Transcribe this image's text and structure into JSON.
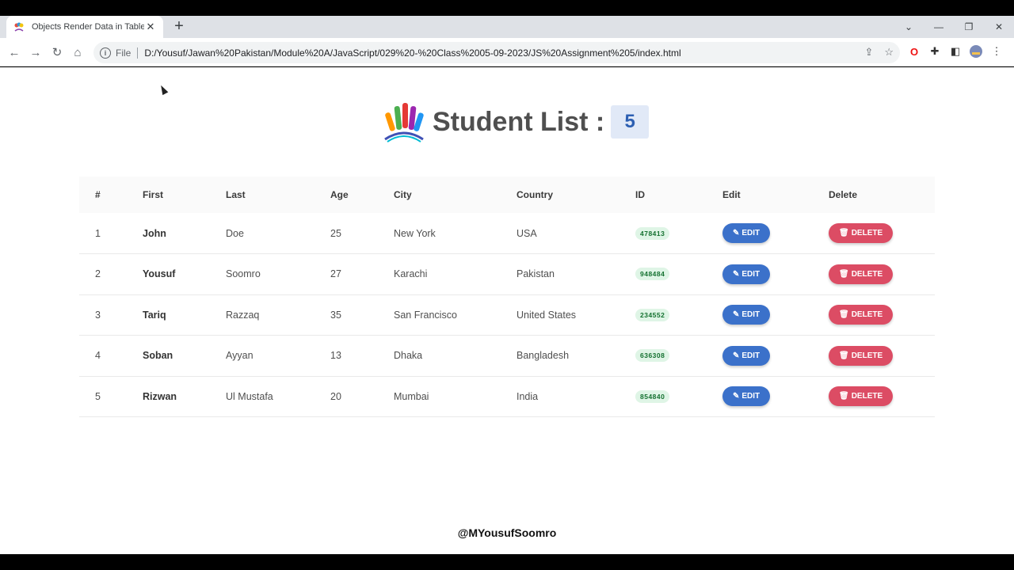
{
  "browser": {
    "tab_title": "Objects Render Data in Table",
    "url_scheme": "File",
    "url": "D:/Yousuf/Jawan%20Pakistan/Module%20A/JavaScript/029%20-%20Class%2005-09-2023/JS%20Assignment%205/index.html"
  },
  "page": {
    "heading": "Student List :",
    "count": "5",
    "footer_handle": "@MYousufSoomro"
  },
  "table": {
    "headers": [
      "#",
      "First",
      "Last",
      "Age",
      "City",
      "Country",
      "ID",
      "Edit",
      "Delete"
    ],
    "edit_label": "EDIT",
    "delete_label": "DELETE",
    "rows": [
      {
        "num": "1",
        "first": "John",
        "last": "Doe",
        "age": "25",
        "city": "New York",
        "country": "USA",
        "id": "478413"
      },
      {
        "num": "2",
        "first": "Yousuf",
        "last": "Soomro",
        "age": "27",
        "city": "Karachi",
        "country": "Pakistan",
        "id": "948484"
      },
      {
        "num": "3",
        "first": "Tariq",
        "last": "Razzaq",
        "age": "35",
        "city": "San Francisco",
        "country": "United States",
        "id": "234552"
      },
      {
        "num": "4",
        "first": "Soban",
        "last": "Ayyan",
        "age": "13",
        "city": "Dhaka",
        "country": "Bangladesh",
        "id": "636308"
      },
      {
        "num": "5",
        "first": "Rizwan",
        "last": "Ul Mustafa",
        "age": "20",
        "city": "Mumbai",
        "country": "India",
        "id": "854840"
      }
    ]
  },
  "colors": {
    "edit_button": "#3b71ca",
    "delete_button": "#dc4c64",
    "id_pill_bg": "#dff5e6",
    "count_badge_bg": "#e1e9f7"
  }
}
